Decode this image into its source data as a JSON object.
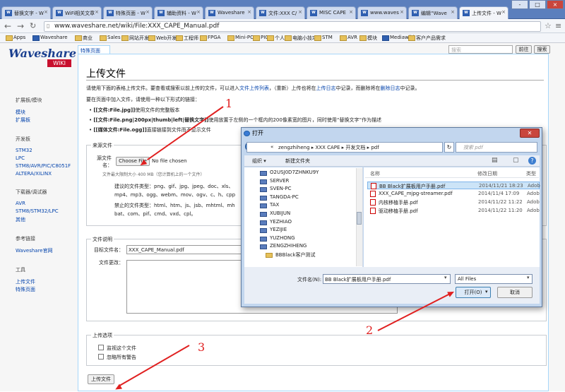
{
  "browser": {
    "tabs": [
      "替换文字 - W",
      "WiFi相关文章",
      "特殊页面 - W",
      "辅助资料 - W",
      "Waveshare",
      "文件:XXX C/",
      "MISC CAPE",
      "www.waves",
      "编辑“Wave",
      "上传文件 - W"
    ],
    "url": "www.waveshare.net/wiki/File:XXX_CAPE_Manual.pdf",
    "bookmarks": [
      "Apps",
      "Waveshare",
      "商业",
      "Sales",
      "网站开发",
      "Web开发",
      "工程师",
      "FPGA",
      "Mini-PC",
      "PIC",
      "个人",
      "电脑小技巧",
      "STM",
      "AVR",
      "模块",
      "Mediawiki",
      "客户产品需求"
    ],
    "win_controls": [
      "-",
      "□",
      "×"
    ]
  },
  "wiki": {
    "logo_text": "Waveshare",
    "logo_badge": "WIKI",
    "special_tab": "特殊页面",
    "search_placeholder": "搜索",
    "go_btn": "前往",
    "search_btn": "搜索",
    "page_title": "上传文件",
    "intro1_a": "请使用下面的表格上传文件。要查看或搜索以前上传的文件，可以进入",
    "intro1_link1": "文件上传列表",
    "intro1_b": "，（重新）上传也将在",
    "intro1_link2": "上传日志",
    "intro1_c": "中记录，而删除将在",
    "intro1_link3": "删除日志",
    "intro1_d": "中记录。",
    "intro2": "要在页面中加入文件，请使用一种以下形式的链接：",
    "bullet1_code": "[[文件:File.jpg]]",
    "bullet1_text": "使用文件的完整版本",
    "bullet2_code": "[[文件:File.png|200px|thumb|left|替换文字]]",
    "bullet2_text": "使用放置于左侧的一个框内的200像素宽的图片，同时使用“替换文字”作为描述",
    "bullet3_code": "[[媒体文件:File.ogg]]",
    "bullet3_text": "直接链接到文件而不显示文件",
    "sidebar": {
      "g1_head": "扩展板/模块",
      "g1": [
        "模块",
        "扩展板"
      ],
      "g2_head": "开发板",
      "g2": [
        "STM32",
        "LPC",
        "STM8/AVR/PIC/C8051F",
        "ALTERA/XILINX"
      ],
      "g3_head": "下载器/调试器",
      "g3": [
        "AVR",
        "STM8/STM32/LPC",
        "其他"
      ],
      "g4_head": "参考链接",
      "g4": [
        "Waveshare官网"
      ],
      "g5_head": "工具",
      "g5": [
        "上传文件",
        "特殊页面"
      ]
    },
    "source": {
      "legend": "来源文件",
      "label_a": "源文件",
      "label_b": "名：",
      "choose_btn": "Choose File",
      "no_file": "No file chosen",
      "max_size": "文件最大限制大小 400 MB（您计算机上的一个文件）",
      "allowed_a": "建议的文件类型：png、gif、jpg、jpeg、doc、xls、",
      "allowed_b": "mp4、mp3、ogg、webm、mov、ogv、c、h、cpp",
      "banned_a": "禁止的文件类型：html、htm、js、jsb、mhtml、mh",
      "banned_b": "bat、com、pif、cmd、vxd、cpl。"
    },
    "desc": {
      "legend": "文件说明",
      "target_label": "目标文件名：",
      "target_value": "XXX_CAPE_Manual.pdf",
      "summary_label": "文件更改："
    },
    "options": {
      "legend": "上传选项",
      "watch": "监视这个文件",
      "ignore": "忽略所有警告"
    },
    "upload_btn": "上传文件"
  },
  "dialog": {
    "title": "打开",
    "path_prefix": "«",
    "path": "zengzhiheng ▸ XXX CAPE ▸ 开发文档 ▸ pdf",
    "search_placeholder": "搜索 pdf",
    "organize": "组织 ▾",
    "new_folder": "新建文件夹",
    "nav_items": [
      "O2USJ0D7ZHNKU9Y",
      "SERVER",
      "SVEN-PC",
      "TANGDA-PC",
      "TAX",
      "XUBIJUN",
      "YEZHIAO",
      "YEZIJIE",
      "YUZHONG",
      "ZENGZHIHENG",
      "BBBlack客户测试"
    ],
    "col_name": "名称",
    "col_date": "修改日期",
    "col_type": "类型",
    "files": [
      {
        "name": "BB Black扩展板用户手册.pdf",
        "date": "2014/11/21 18:23",
        "type": "Adob"
      },
      {
        "name": "XXX_CAPE_mjpg-streamer.pdf",
        "date": "2014/11/4 17:09",
        "type": "Adob"
      },
      {
        "name": "内核移植手册.pdf",
        "date": "2014/11/22 11:22",
        "type": "Adob"
      },
      {
        "name": "驱动移植手册.pdf",
        "date": "2014/11/22 11:20",
        "type": "Adob"
      }
    ],
    "filename_label": "文件名(N):",
    "filename_value": "BB Black扩展板用户手册.pdf",
    "filter": "All Files",
    "open_btn": "打开(O)",
    "cancel_btn": "取消"
  },
  "annotations": [
    "1",
    "2",
    "3"
  ],
  "colors": {
    "accent": "#e02020",
    "link": "#0645ad",
    "brand": "#c8102e"
  }
}
